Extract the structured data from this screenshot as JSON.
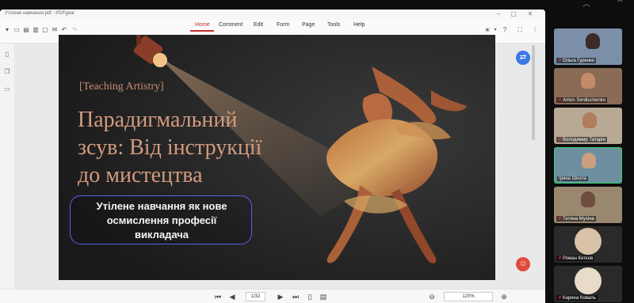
{
  "window": {
    "title": "Утілене навчання.pdf - PDFgear"
  },
  "menu": {
    "items": [
      "Home",
      "Comment",
      "Edit",
      "Form",
      "Page",
      "Tools",
      "Help"
    ],
    "active": "Home"
  },
  "slide": {
    "bracket_label": "[Teaching Artistry]",
    "headline": [
      "Парадигмальний",
      "зсув: Від інструкції",
      "до мистецтва"
    ],
    "subtitle": [
      "Утілене навчання як нове",
      "осмислення професії",
      "викладача"
    ]
  },
  "status": {
    "page_indicator": "1/32",
    "zoom": "120%"
  },
  "participants": [
    {
      "name": "Ольга Гуренко"
    },
    {
      "name": "Anton Serdiuchenko"
    },
    {
      "name": "Володимир Татарін"
    },
    {
      "name": "Ірина Школа",
      "speaking": true
    },
    {
      "name": "Тетяна Мухіна"
    },
    {
      "name": "Роман Кетков"
    },
    {
      "name": "Карина Коваль"
    }
  ],
  "colors": {
    "accent": "#c0322a",
    "speaking_border": "#2fd46a",
    "slide_text": "#d39b7e"
  },
  "icons": [
    "chevron-down-icon",
    "save-icon",
    "print-icon",
    "undo-icon",
    "redo-icon",
    "settings-icon",
    "help-icon",
    "fit-icon",
    "more-icon",
    "bookmark-icon",
    "thumbnails-icon",
    "comments-icon",
    "first-page-icon",
    "prev-page-icon",
    "next-page-icon",
    "last-page-icon",
    "zoom-out-icon",
    "zoom-in-icon",
    "translate-icon",
    "ai-assistant-icon"
  ]
}
